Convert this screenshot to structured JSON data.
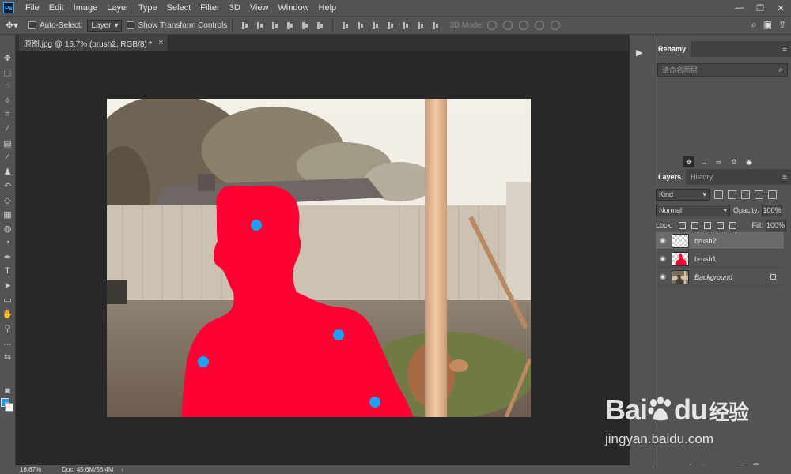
{
  "menubar": {
    "logo": "Ps",
    "items": [
      "File",
      "Edit",
      "Image",
      "Layer",
      "Type",
      "Select",
      "Filter",
      "3D",
      "View",
      "Window",
      "Help"
    ]
  },
  "window_controls": {
    "minimize": "—",
    "restore": "❐",
    "close": "✕"
  },
  "options": {
    "auto_select_label": "Auto-Select:",
    "auto_select_target": "Layer",
    "show_transform_label": "Show Transform Controls",
    "mode_3d_label": "3D Mode:"
  },
  "document_tab": {
    "title": "原图.jpg @ 16.7% (brush2, RGB/8) *",
    "close": "×"
  },
  "status": {
    "zoom": "16.67%",
    "doc": "Doc: 45.6M/56.4M",
    "arrow": "›"
  },
  "renamy_panel": {
    "title": "Renamy",
    "search_placeholder": "请命名图层"
  },
  "layers_panel": {
    "tabs": [
      "Layers",
      "History"
    ],
    "kind_label": "Kind",
    "blend_mode": "Normal",
    "opacity_label": "Opacity:",
    "opacity_value": "100%",
    "lock_label": "Lock:",
    "fill_label": "Fill:",
    "fill_value": "100%",
    "layers": [
      {
        "name": "brush2",
        "visible": true,
        "selected": true
      },
      {
        "name": "brush1",
        "visible": true,
        "selected": false
      },
      {
        "name": "Background",
        "visible": true,
        "selected": false,
        "locked": true
      }
    ]
  },
  "footer_icons": [
    "∞",
    "fx",
    "◘",
    "◐",
    "▭",
    "⊞",
    "🗑"
  ],
  "watermark": {
    "brand": "Bai",
    "brand_tail": "du",
    "cn": "经验",
    "url": "jingyan.baidu.com"
  },
  "colors": {
    "foreground": "#1e9bf0",
    "background": "#ffffff",
    "mask": "#ff0033",
    "marker": "#1ea0f5"
  }
}
